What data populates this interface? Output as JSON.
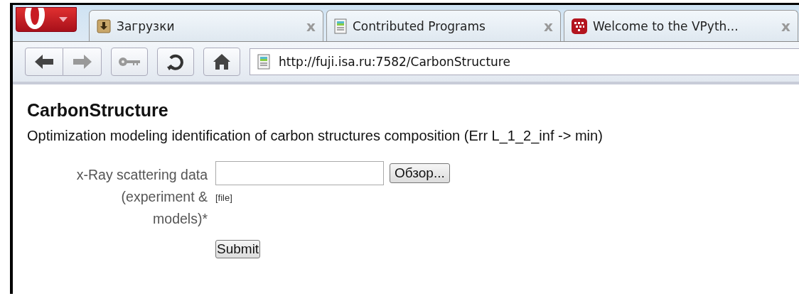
{
  "browser": {
    "tabs": [
      {
        "kind": "download",
        "title": "Загрузки",
        "close": "x"
      },
      {
        "kind": "page",
        "title": "Contributed Programs",
        "close": "x"
      },
      {
        "kind": "app",
        "title": "Welcome to the VPyth...",
        "close": "x"
      }
    ],
    "address": "http://fuji.isa.ru:7582/CarbonStructure"
  },
  "page": {
    "title": "CarbonStructure",
    "description": "Optimization modeling identification of carbon structures composition (Err L_1_2_inf -> min)",
    "form": {
      "field_label": "x-Ray scattering data (experiment & models)*",
      "browse_button": "Обзор...",
      "hint": "[file]",
      "submit": "Submit"
    }
  }
}
